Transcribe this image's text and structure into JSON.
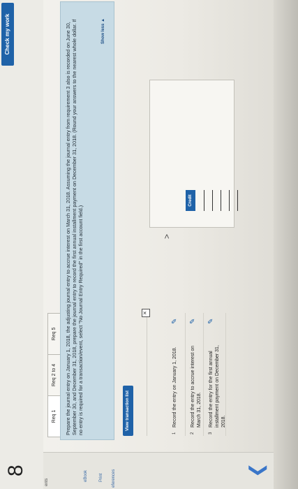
{
  "header": {
    "problem_number": "8",
    "check_button": "Check my work"
  },
  "side_nav": {
    "top_text": "ents",
    "items": [
      "eBook",
      "Print",
      "eferences"
    ]
  },
  "tabs": [
    {
      "label": "Req 1"
    },
    {
      "label": "Req 2 to 4"
    },
    {
      "label": "Req 5"
    }
  ],
  "instructions": {
    "text": "Prepare the journal entry on January 1, 2018, the adjusting journal entry to accrue interest on March 31, 2018. Assuming the journal entry from requirement 3 also is recorded on June 30, September 30, and December 31, 2018, prepare the journal entry to record the first annual installment payment on December 31, 2018. (Round your answers to the nearest whole dollar. If no entry is required for a transaction/event, select \"No Journal Entry Required\" in the first account field.)",
    "toggle": "Show less ▲"
  },
  "view_transaction_button": "View transaction list",
  "close_icon_glyph": "✕",
  "transactions": [
    {
      "num": "1",
      "label": "Record the entry on January 1, 2018."
    },
    {
      "num": "2",
      "label": "Record the entry to accrue interest on March 31, 2018."
    },
    {
      "num": "3",
      "label": "Record the entry for the first annual installment payment on December 31, 2018."
    }
  ],
  "journal": {
    "credit_header": "Credit",
    "next_glyph": ">"
  },
  "colors": {
    "accent": "#1f62a8",
    "instructions_bg": "#c7dbe5"
  }
}
